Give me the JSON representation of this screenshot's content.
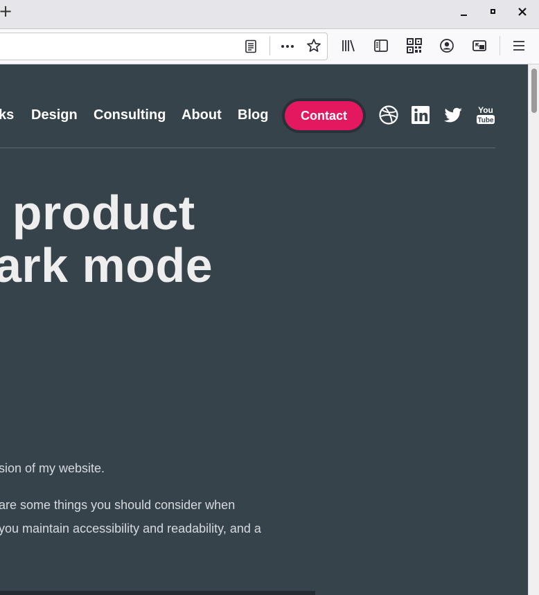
{
  "browser": {
    "new_tab_glyph": "+",
    "window_controls": [
      "minimize",
      "maximize",
      "close"
    ],
    "toolbar_icons": [
      "reader-view-icon",
      "more-icon",
      "bookmark-star-icon",
      "library-icon",
      "sidebar-icon",
      "qr-code-icon",
      "account-icon",
      "picture-in-picture-icon",
      "hamburger-menu-icon"
    ]
  },
  "site": {
    "nav": {
      "works_label": "ks",
      "design_label": "Design",
      "consulting_label": "Consulting",
      "about_label": "About",
      "blog_label": "Blog",
      "contact_label": "Contact"
    },
    "social_icons": [
      "dribbble-icon",
      "linkedin-icon",
      "twitter-icon",
      "youtube-icon"
    ],
    "youtube_text_top": "You",
    "youtube_text_bottom": "Tube",
    "headline_line1": "r product",
    "headline_line2": "lark mode",
    "paragraph1": "sion of my website.",
    "paragraph2_line1": "are some things you should consider when",
    "paragraph2_line2": "you maintain accessibility and readability, and a"
  },
  "colors": {
    "page_background": "#37434b",
    "accent": "#e4185f",
    "heading": "#eeeeee",
    "body_text": "#d6dade"
  }
}
